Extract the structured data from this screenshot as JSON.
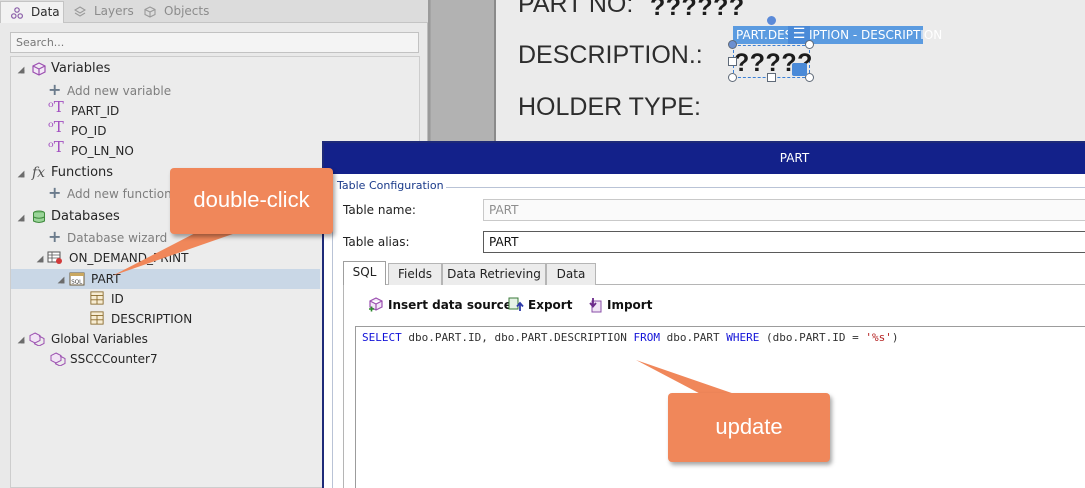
{
  "left_panel": {
    "tabs": [
      {
        "label": "Data",
        "icon": "data-icon",
        "active": true
      },
      {
        "label": "Layers",
        "icon": "layers-icon",
        "active": false
      },
      {
        "label": "Objects",
        "icon": "objects-icon",
        "active": false
      }
    ],
    "search_placeholder": "Search...",
    "tree": {
      "variables": {
        "label": "Variables",
        "add_label": "Add new variable",
        "items": [
          "PART_ID",
          "PO_ID",
          "PO_LN_NO"
        ]
      },
      "functions": {
        "label": "Functions",
        "add_label": "Add new function"
      },
      "databases": {
        "label": "Databases",
        "wizard_label": "Database wizard",
        "connection_label": "ON_DEMAND_PRINT",
        "table_label": "PART",
        "fields": [
          "ID",
          "DESCRIPTION"
        ]
      },
      "global_variables": {
        "label": "Global Variables",
        "items": [
          "SSCCCounter7"
        ]
      }
    }
  },
  "design_area": {
    "labels": [
      "PART NO:",
      "DESCRIPTION.:",
      "HOLDER TYPE:"
    ],
    "placeholders": [
      "??????",
      "?????"
    ],
    "field_tag": "PART.DESCRIPTION - DESCRIPTION"
  },
  "dialog": {
    "title": "PART",
    "group_caption": "Table Configuration",
    "table_name_label": "Table name:",
    "table_name_value": "PART",
    "table_alias_label": "Table alias:",
    "table_alias_value": "PART",
    "tabs": [
      "SQL",
      "Fields",
      "Data Retrieving",
      "Data"
    ],
    "toolbar": {
      "insert_label": "Insert data source",
      "export_label": "Export",
      "import_label": "Import"
    },
    "sql": {
      "kw_select": "SELECT",
      "fields": " dbo.PART.ID, dbo.PART.DESCRIPTION ",
      "kw_from": "FROM",
      "table": " dbo.PART ",
      "kw_where": "WHERE",
      "condition": " (dbo.PART.ID = ",
      "param": "'%s'",
      "close": ")"
    }
  },
  "callouts": {
    "double_click": "double-click",
    "update": "update"
  },
  "colors": {
    "callout": "#f0875a",
    "dialog_title_bg": "#13218a",
    "selection": "#5b9be0",
    "sql_keyword": "#1212d8",
    "sql_string": "#b52121"
  }
}
